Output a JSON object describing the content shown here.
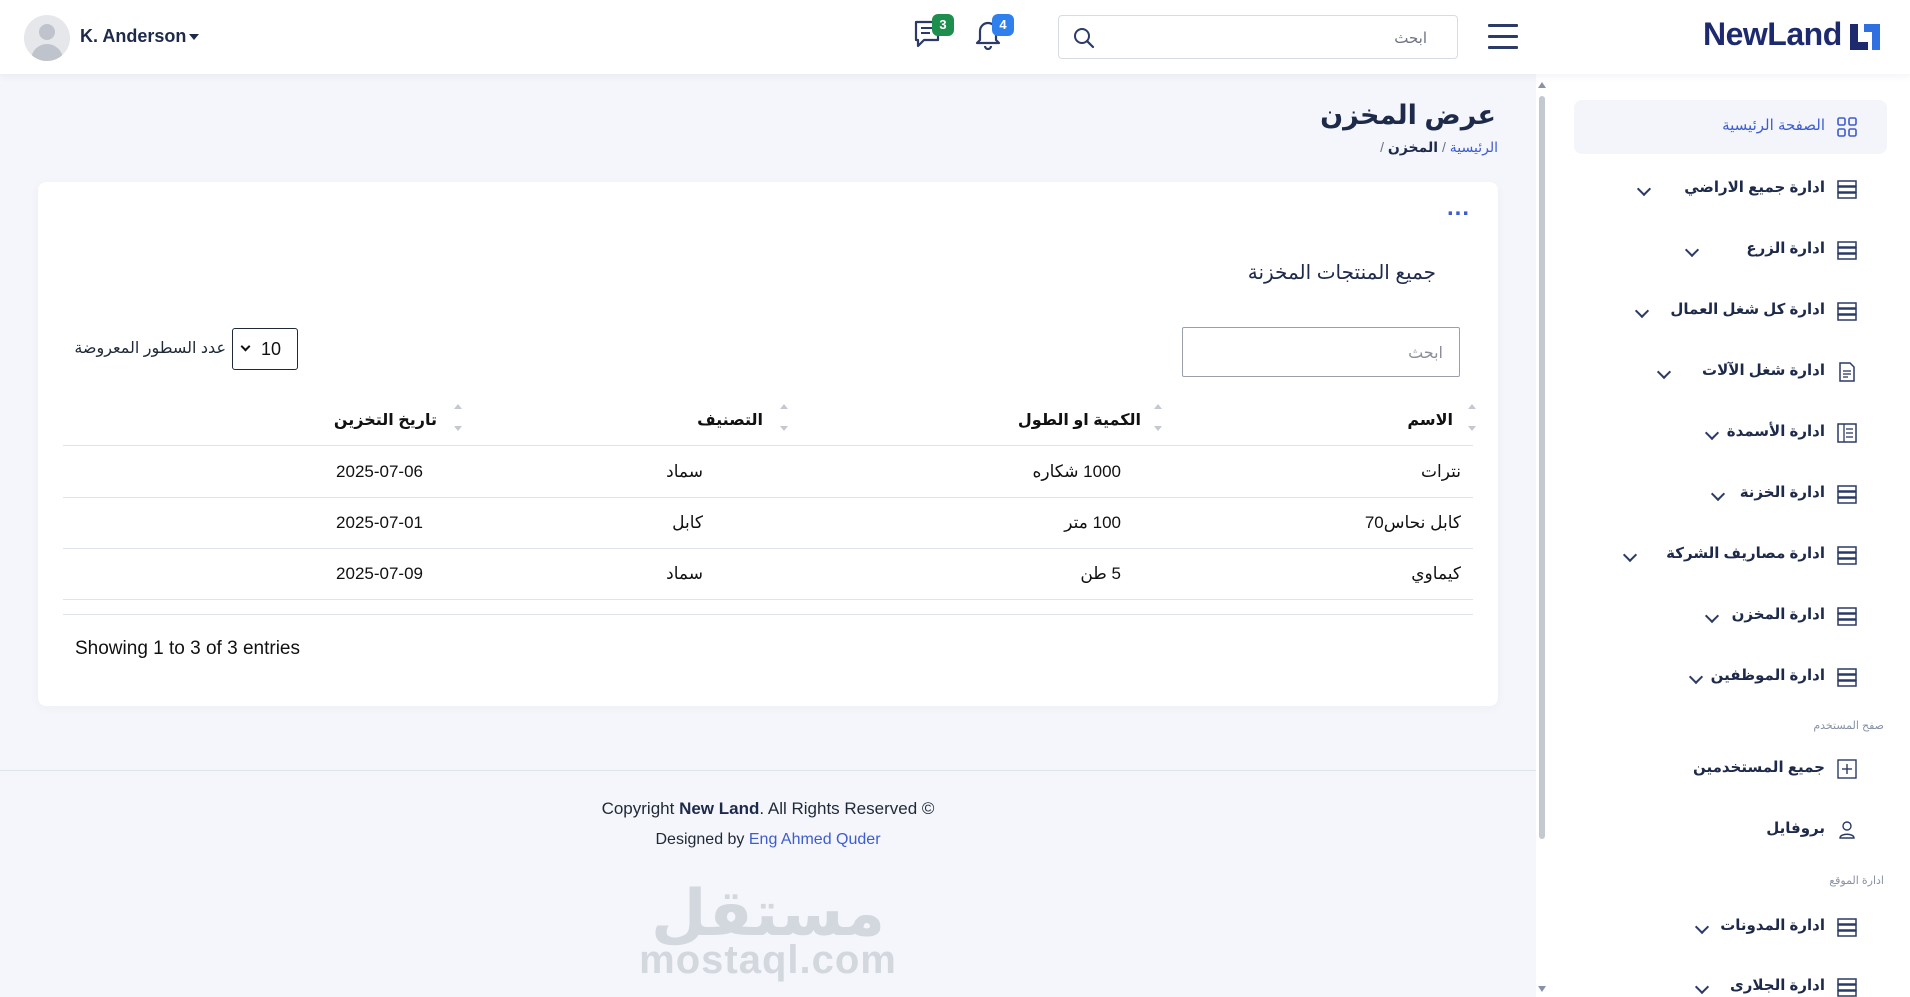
{
  "header": {
    "user_name": "K. Anderson",
    "messages_badge": "3",
    "notifications_badge": "4",
    "search_placeholder": "ابحث",
    "brand": "NewLand",
    "colors": {
      "messages_badge": "#1e8e4e",
      "notifications_badge": "#2f80ed"
    }
  },
  "sidebar": {
    "items": [
      {
        "label": "الصفحة الرئيسية",
        "icon": "grid-icon"
      },
      {
        "label": "ادارة جميع الاراضي",
        "icon": "server-icon"
      },
      {
        "label": "ادارة الزرع",
        "icon": "server-icon"
      },
      {
        "label": "ادارة كل شغل العمال",
        "icon": "server-icon"
      },
      {
        "label": "ادارة شغل الآلات",
        "icon": "document-icon"
      },
      {
        "label": "ادارة الأسمدة",
        "icon": "list-icon"
      },
      {
        "label": "ادارة الخزنة",
        "icon": "server-icon"
      },
      {
        "label": "ادارة مصاريف الشركة",
        "icon": "server-icon"
      },
      {
        "label": "ادارة المخزن",
        "icon": "server-icon"
      },
      {
        "label": "ادارة الموظفين",
        "icon": "server-icon"
      }
    ],
    "section_user": "صفح المستخدم",
    "user_items": [
      {
        "label": "جميع المستخدمين",
        "icon": "plus-square-icon"
      },
      {
        "label": "بروفايل",
        "icon": "user-icon"
      }
    ],
    "section_site": "ادارة الموقع",
    "site_items": [
      {
        "label": "ادارة المدونات",
        "icon": "server-icon"
      },
      {
        "label": "ادارة الجلارى",
        "icon": "server-icon"
      }
    ]
  },
  "page": {
    "title": "عرض المخزن",
    "breadcrumb_home": "الرئيسية",
    "breadcrumb_sep": "/",
    "breadcrumb_current": "المخزن",
    "breadcrumb_trail": "/"
  },
  "card": {
    "menu": "...",
    "title": "جميع المنتجات المخزنة",
    "search_placeholder": "ابحث",
    "length_value": "10",
    "length_label": "عدد السطور المعروضة",
    "columns": [
      "الاسم",
      "الكمية او الطول",
      "التصنيف",
      "تاريخ التخزين"
    ],
    "rows": [
      [
        "نترات",
        "1000 شكاره",
        "سماد",
        "2025-07-06"
      ],
      [
        "كابل نحاس70",
        "100 متر",
        "كابل",
        "2025-07-01"
      ],
      [
        "كيماوي",
        "5 طن",
        "سماد",
        "2025-07-09"
      ]
    ],
    "info": "Showing 1 to 3 of 3 entries"
  },
  "footer": {
    "copyright_prefix": "Copyright ",
    "copyright_brand": "New Land",
    "copyright_suffix": ". All Rights Reserved ©",
    "designed_prefix": "Designed by ",
    "designed_author": "Eng Ahmed Quder",
    "watermark_ar": "مستقل",
    "watermark_en": "mostaql.com"
  }
}
